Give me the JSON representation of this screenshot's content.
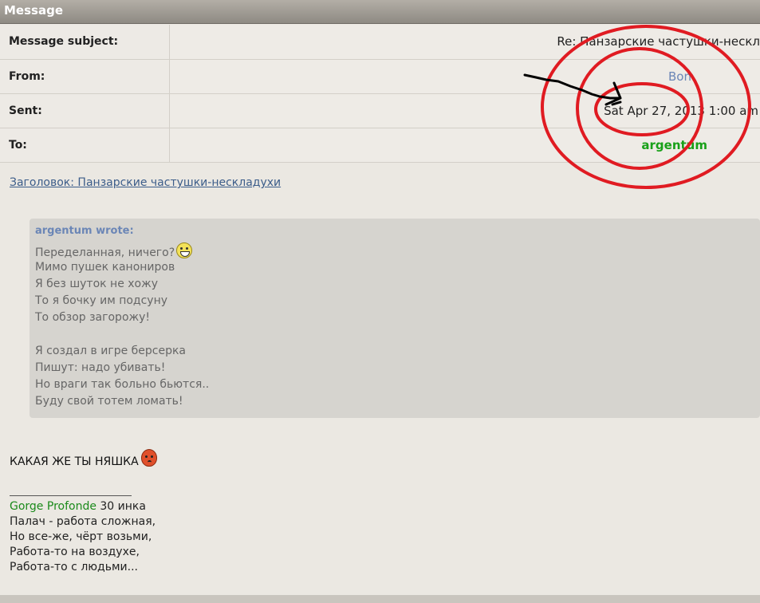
{
  "window": {
    "title": "Message"
  },
  "header": {
    "subject_label": "Message subject:",
    "subject_value": "Re: Панзарские частушки-нескл",
    "from_label": "From:",
    "from_value": "Bon",
    "sent_label": "Sent:",
    "sent_value": "Sat Apr 27, 2013 1:00 am",
    "to_label": "To:",
    "to_value": "argentum"
  },
  "thread_link": "Заголовок: Панзарские частушки-нескладухи",
  "quote": {
    "author": "argentum wrote:",
    "lines1": [
      "Переделанная, ничего?",
      "Мимо пушек канониров",
      "Я без шуток не хожу",
      "То я бочку им подсуну",
      "То обзор загорожу!"
    ],
    "lines2": [
      "Я создал в игре берсерка",
      "Пишут: надо убивать!",
      "Но враги так больно бьются..",
      "Буду свой тотем ломать!"
    ],
    "smiley_icon": "laughing-smiley-icon"
  },
  "message_text": "КАКАЯ ЖЕ ТЫ НЯШКА",
  "message_emoticon": "angry-face-icon",
  "signature": {
    "name": "Gorge Profonde",
    "level": " 30 инка",
    "lines": [
      "Палач - работа сложная,",
      "Но все-же, чёрт возьми,",
      "Работа-то на воздухе,",
      "Работа-то с людьми..."
    ]
  },
  "colors": {
    "annotation_red": "#e01b22",
    "annotation_arrow": "#000000",
    "link_blue": "#3c5d8a",
    "user_green": "#18a018"
  }
}
